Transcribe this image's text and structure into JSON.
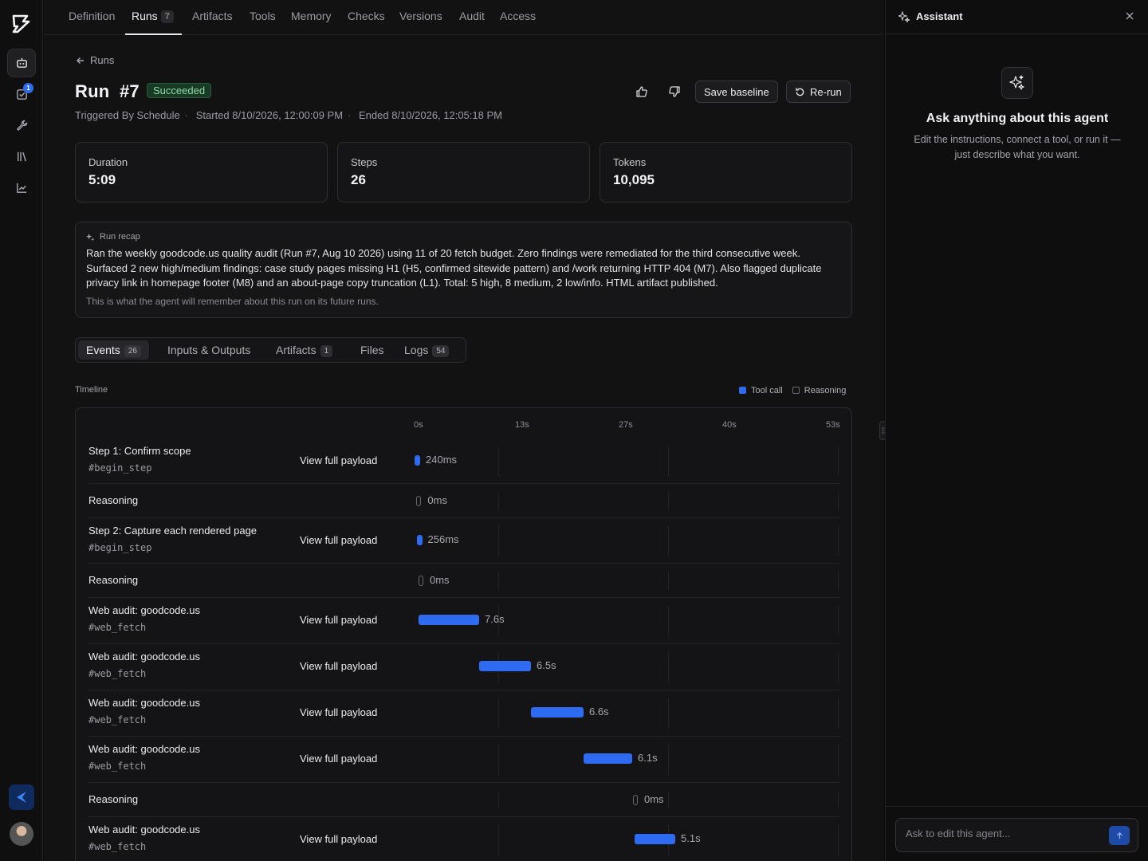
{
  "rail": {
    "items": [
      {
        "name": "agent-icon"
      },
      {
        "name": "checklist-icon",
        "badge": "1"
      },
      {
        "name": "wrench-icon"
      },
      {
        "name": "library-icon"
      },
      {
        "name": "chart-icon"
      }
    ]
  },
  "tabs": [
    {
      "label": "Definition"
    },
    {
      "label": "Runs",
      "count": "7"
    },
    {
      "label": "Artifacts"
    },
    {
      "label": "Tools"
    },
    {
      "label": "Memory"
    },
    {
      "label": "Checks"
    },
    {
      "label": "Versions"
    },
    {
      "label": "Audit"
    },
    {
      "label": "Access"
    }
  ],
  "header": {
    "back_label": "Runs",
    "title": "Run  #7",
    "status": "Succeeded",
    "triggered": "Triggered By Schedule",
    "started": "Started 8/10/2026, 12:00:09 PM",
    "ended": "Ended 8/10/2026, 12:05:18 PM",
    "save_baseline": "Save baseline",
    "rerun": "Re-run"
  },
  "stats": [
    {
      "label": "Duration",
      "value": "5:09"
    },
    {
      "label": "Steps",
      "value": "26"
    },
    {
      "label": "Tokens",
      "value": "10,095"
    }
  ],
  "recap": {
    "heading": "Run recap",
    "body": "Ran the weekly goodcode.us quality audit (Run #7, Aug 10 2026) using 11 of 20 fetch budget. Zero findings were remediated for the third consecutive week. Surfaced 2 new high/medium findings: case study pages missing H1 (H5, confirmed sitewide pattern) and /work returning HTTP 404 (M7). Also flagged duplicate privacy link in homepage footer (M8) and an about-page copy truncation (L1). Total: 5 high, 8 medium, 2 low/info. HTML artifact published.",
    "note": "This is what the agent will remember about this run on its future runs."
  },
  "subtabs": [
    {
      "label": "Events",
      "count": "26"
    },
    {
      "label": "Inputs & Outputs"
    },
    {
      "label": "Artifacts",
      "count": "1"
    },
    {
      "label": "Files"
    },
    {
      "label": "Logs",
      "count": "54"
    }
  ],
  "timeline": {
    "label": "Timeline",
    "legend": {
      "tool_call": "Tool call",
      "reasoning": "Reasoning"
    },
    "colors": {
      "tool_call": "#2f6bf0"
    },
    "axis_ticks": [
      "0s",
      "13s",
      "27s",
      "40s",
      "53s"
    ],
    "axis_max_s": 53,
    "payload_label": "View full payload",
    "rows": [
      {
        "type": "tool",
        "name": "Step 1: Confirm scope",
        "tool": "#begin_step",
        "start_s": 0,
        "duration_s": 0.24,
        "duration_label": "240ms"
      },
      {
        "type": "reasoning",
        "name": "Reasoning",
        "start_s": 0.24,
        "duration_s": 0,
        "duration_label": "0ms"
      },
      {
        "type": "tool",
        "name": "Step 2: Capture each rendered page",
        "tool": "#begin_step",
        "start_s": 0.25,
        "duration_s": 0.256,
        "duration_label": "256ms"
      },
      {
        "type": "reasoning",
        "name": "Reasoning",
        "start_s": 0.5,
        "duration_s": 0,
        "duration_label": "0ms"
      },
      {
        "type": "tool",
        "name": "Web audit: goodcode.us",
        "tool": "#web_fetch",
        "start_s": 0.5,
        "duration_s": 7.6,
        "duration_label": "7.6s"
      },
      {
        "type": "tool",
        "name": "Web audit: goodcode.us",
        "tool": "#web_fetch",
        "start_s": 8.1,
        "duration_s": 6.5,
        "duration_label": "6.5s"
      },
      {
        "type": "tool",
        "name": "Web audit: goodcode.us",
        "tool": "#web_fetch",
        "start_s": 14.6,
        "duration_s": 6.6,
        "duration_label": "6.6s"
      },
      {
        "type": "tool",
        "name": "Web audit: goodcode.us",
        "tool": "#web_fetch",
        "start_s": 21.2,
        "duration_s": 6.1,
        "duration_label": "6.1s"
      },
      {
        "type": "reasoning",
        "name": "Reasoning",
        "start_s": 27.4,
        "duration_s": 0,
        "duration_label": "0ms"
      },
      {
        "type": "tool",
        "name": "Web audit: goodcode.us",
        "tool": "#web_fetch",
        "start_s": 27.6,
        "duration_s": 5.1,
        "duration_label": "5.1s"
      }
    ]
  },
  "assistant": {
    "title": "Assistant",
    "ask_title": "Ask anything about this agent",
    "ask_sub": "Edit the instructions, connect a tool, or run it — just describe what you want.",
    "input_placeholder": "Ask to edit this agent..."
  }
}
